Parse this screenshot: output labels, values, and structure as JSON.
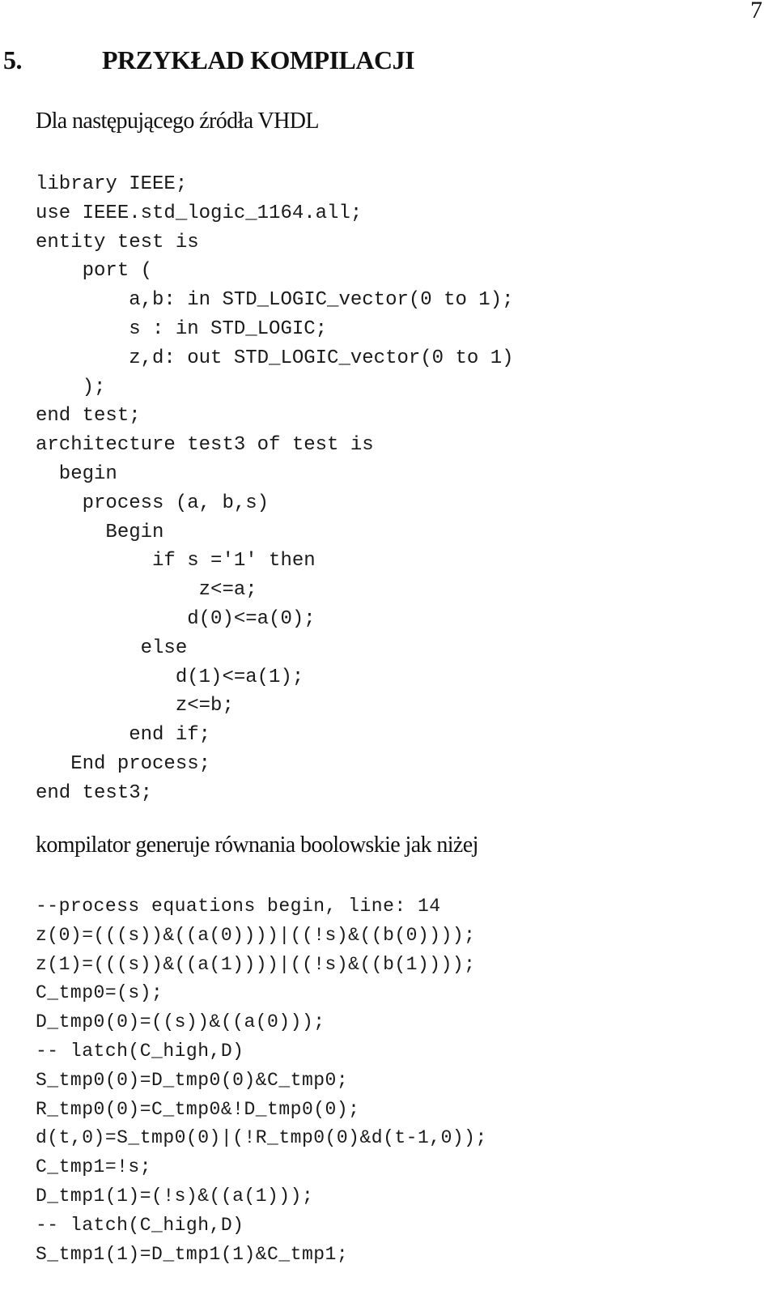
{
  "page": {
    "number": "7",
    "section_number": "5.",
    "section_title": "PRZYKŁAD KOMPILACJI",
    "intro_text": "Dla następującego źródła  VHDL",
    "vhdl_source": [
      "library IEEE;",
      "use IEEE.std_logic_1164.all;",
      "entity test is",
      "    port (",
      "        a,b: in STD_LOGIC_vector(0 to 1);",
      "        s : in STD_LOGIC;",
      "        z,d: out STD_LOGIC_vector(0 to 1)",
      "    );",
      "end test;",
      "architecture test3 of test is",
      "  begin",
      "    process (a, b,s)",
      "      Begin",
      "          if s ='1' then",
      "              z<=a;",
      "             d(0)<=a(0);",
      "         else",
      "            d(1)<=a(1);",
      "            z<=b;",
      "        end if;",
      "   End process;",
      "end test3;"
    ],
    "middle_text": "kompilator generuje równania boolowskie jak niżej",
    "equations": [
      "--process equations begin, line: 14",
      "z(0)=(((s))&((a(0))))|((!s)&((b(0))));",
      "z(1)=(((s))&((a(1))))|((!s)&((b(1))));",
      "C_tmp0=(s);",
      "D_tmp0(0)=((s))&((a(0)));",
      "-- latch(C_high,D)",
      "S_tmp0(0)=D_tmp0(0)&C_tmp0;",
      "R_tmp0(0)=C_tmp0&!D_tmp0(0);",
      "d(t,0)=S_tmp0(0)|(!R_tmp0(0)&d(t-1,0));",
      "C_tmp1=!s;",
      "D_tmp1(1)=(!s)&((a(1)));",
      "-- latch(C_high,D)",
      "S_tmp1(1)=D_tmp1(1)&C_tmp1;"
    ]
  }
}
